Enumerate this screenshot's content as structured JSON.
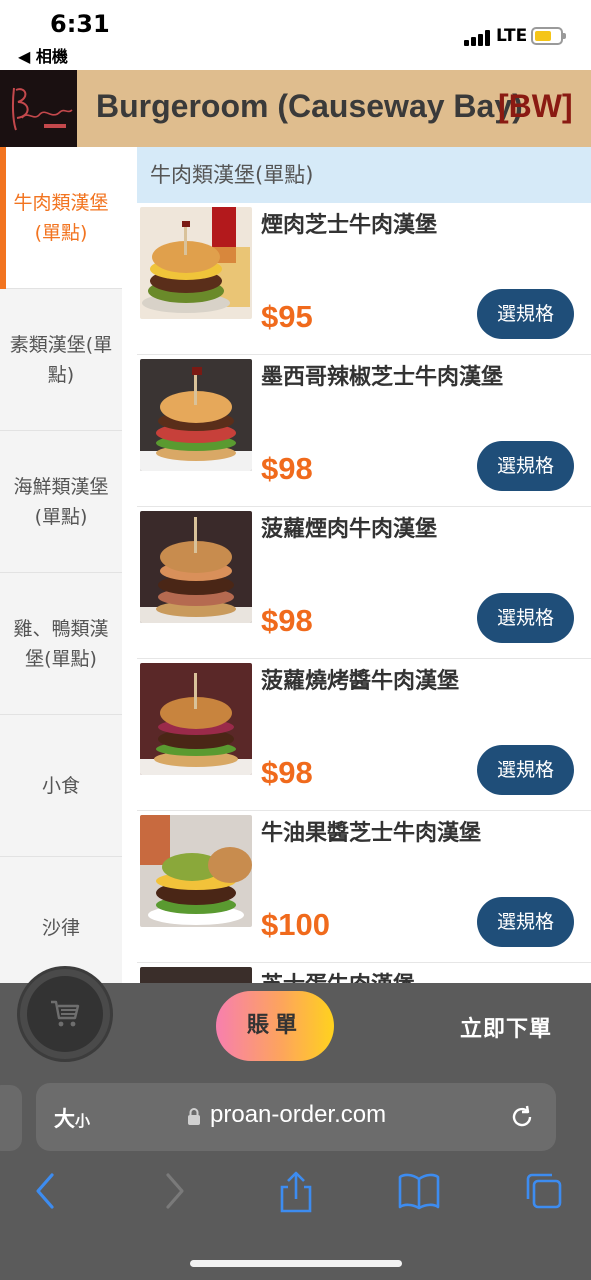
{
  "status_bar": {
    "time": "6:31",
    "back_app": "◀ 相機",
    "network": "LTE"
  },
  "header": {
    "restaurant_name": "Burgeroom (Causeway Bay)",
    "branch_code": "[BW]",
    "logo_text": "BurgeRoom"
  },
  "sidebar": {
    "categories": [
      {
        "label": "牛肉類漢堡(單點)",
        "active": true
      },
      {
        "label": "素類漢堡(單點)"
      },
      {
        "label": "海鮮類漢堡(單點)"
      },
      {
        "label": "雞、鴨類漢堡(單點)"
      },
      {
        "label": "小食"
      },
      {
        "label": "沙律"
      }
    ]
  },
  "menu": {
    "section_title": "牛肉類漢堡(單點)",
    "spec_label": "選規格",
    "items": [
      {
        "name": "煙肉芝士牛肉漢堡",
        "price": "$95"
      },
      {
        "name": "墨西哥辣椒芝士牛肉漢堡",
        "price": "$98"
      },
      {
        "name": "菠蘿煙肉牛肉漢堡",
        "price": "$98"
      },
      {
        "name": "菠蘿燒烤醬牛肉漢堡",
        "price": "$98"
      },
      {
        "name": "牛油果醬芝士牛肉漢堡",
        "price": "$100"
      },
      {
        "name": "芝士蛋牛肉漢堡",
        "price": ""
      }
    ]
  },
  "cart_bar": {
    "bill_label": "賬單",
    "order_now_label": "立即下單"
  },
  "browser": {
    "text_size_label": "大",
    "text_size_small": "小",
    "url": "proan-order.com"
  },
  "colors": {
    "accent_orange": "#f27420",
    "price_orange": "#f06a1c",
    "button_navy": "#1f4e79",
    "header_tan": "#dfbd8e",
    "section_blue": "#d6eaf8"
  }
}
